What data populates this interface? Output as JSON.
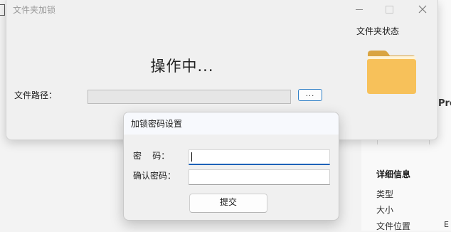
{
  "background": {
    "edge_text": "Pro",
    "details_title": "详细信息",
    "type_label": "类型",
    "size_label": "大小",
    "location_label": "文件位置",
    "edge_small": "E"
  },
  "main_window": {
    "title": "文件夹加锁",
    "status_text": "操作中...",
    "folder_status_label": "文件夹状态",
    "path_label": "文件路径：",
    "path_value": "",
    "browse_label": "...",
    "folder_color": "#f7c15a"
  },
  "dialog": {
    "title": "加锁密码设置",
    "password_label": "密    码：",
    "password_value": "",
    "confirm_label": "确认密码：",
    "confirm_value": "",
    "submit_label": "提交",
    "focus_color": "#1e62b8"
  }
}
